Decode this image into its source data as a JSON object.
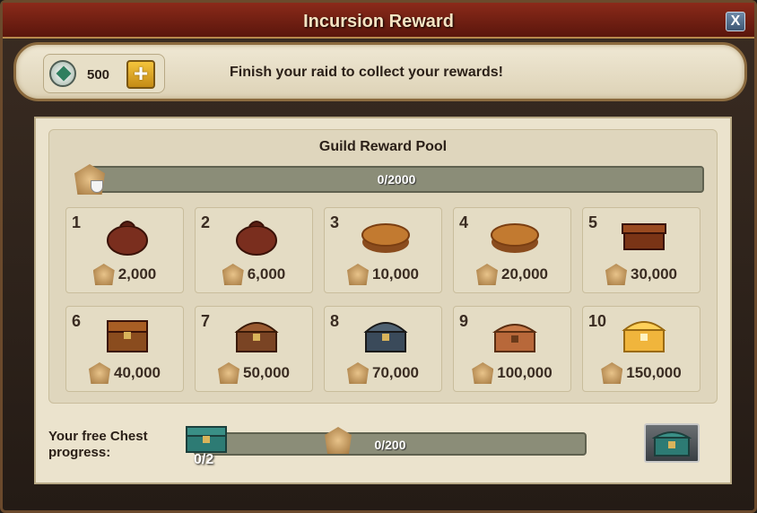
{
  "window": {
    "title": "Incursion Reward",
    "close_label": "X"
  },
  "banner": {
    "currency_value": "500",
    "add_label": "+",
    "message": "Finish your raid to collect your rewards!"
  },
  "pool": {
    "title": "Guild Reward Pool",
    "progress_text": "0/2000",
    "progress_fraction": 0
  },
  "rewards": [
    {
      "num": "1",
      "value": "2,000",
      "icon": "leather-sack-icon"
    },
    {
      "num": "2",
      "value": "6,000",
      "icon": "leather-sack-icon"
    },
    {
      "num": "3",
      "value": "10,000",
      "icon": "wooden-disc-icon"
    },
    {
      "num": "4",
      "value": "20,000",
      "icon": "wooden-disc-icon"
    },
    {
      "num": "5",
      "value": "30,000",
      "icon": "wooden-box-icon"
    },
    {
      "num": "6",
      "value": "40,000",
      "icon": "wooden-chest-icon"
    },
    {
      "num": "7",
      "value": "50,000",
      "icon": "round-chest-icon"
    },
    {
      "num": "8",
      "value": "70,000",
      "icon": "iron-chest-icon"
    },
    {
      "num": "9",
      "value": "100,000",
      "icon": "ornate-chest-icon"
    },
    {
      "num": "10",
      "value": "150,000",
      "icon": "golden-chest-icon"
    }
  ],
  "free_chest": {
    "label": "Your free Chest progress:",
    "progress_text": "0/200",
    "progress_fraction": 0,
    "count": "0/2"
  },
  "colors": {
    "title_bar": "#8b2a1a",
    "bar_fill": "#8b8d78",
    "badge": "#c99a5a"
  }
}
